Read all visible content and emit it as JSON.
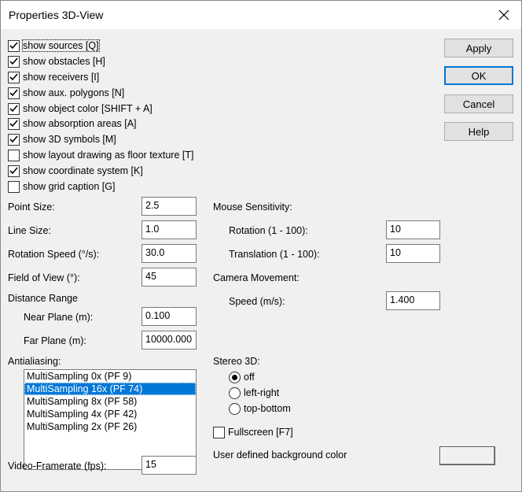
{
  "window": {
    "title": "Properties 3D-View"
  },
  "checkboxes": [
    {
      "label": "show sources [Q]",
      "checked": true
    },
    {
      "label": "show obstacles [H]",
      "checked": true
    },
    {
      "label": "show receivers [I]",
      "checked": true
    },
    {
      "label": "show aux. polygons [N]",
      "checked": true
    },
    {
      "label": "show object color [SHIFT + A]",
      "checked": true
    },
    {
      "label": "show absorption areas [A]",
      "checked": true
    },
    {
      "label": "show 3D symbols [M]",
      "checked": true
    },
    {
      "label": "show layout drawing as floor texture [T]",
      "checked": false
    },
    {
      "label": "show coordinate system [K]",
      "checked": true
    },
    {
      "label": "show grid caption [G]",
      "checked": false
    }
  ],
  "buttons": {
    "apply": "Apply",
    "ok": "OK",
    "cancel": "Cancel",
    "help": "Help"
  },
  "left_fields": {
    "point_size": {
      "label": "Point Size:",
      "value": "2.5"
    },
    "line_size": {
      "label": "Line Size:",
      "value": "1.0"
    },
    "rotation_speed": {
      "label": "Rotation Speed (°/s):",
      "value": "30.0"
    },
    "field_of_view": {
      "label": "Field of View (°):",
      "value": "45"
    },
    "distance_range_label": "Distance Range",
    "near_plane": {
      "label": "Near Plane (m):",
      "value": "0.100"
    },
    "far_plane": {
      "label": "Far Plane (m):",
      "value": "10000.000"
    }
  },
  "antialiasing": {
    "label": "Antialiasing:",
    "options": [
      "MultiSampling 0x (PF 9)",
      "MultiSampling 16x (PF 74)",
      "MultiSampling 8x (PF 58)",
      "MultiSampling 4x (PF 42)",
      "MultiSampling 2x (PF 26)"
    ],
    "selected_index": 1
  },
  "video_framerate": {
    "label": "Video-Framerate (fps):",
    "value": "15"
  },
  "mouse_sensitivity": {
    "label": "Mouse Sensitivity:",
    "rotation": {
      "label": "Rotation (1 - 100):",
      "value": "10"
    },
    "translation": {
      "label": "Translation (1 - 100):",
      "value": "10"
    }
  },
  "camera_movement": {
    "label": "Camera Movement:",
    "speed": {
      "label": "Speed (m/s):",
      "value": "1.400"
    }
  },
  "stereo_3d": {
    "label": "Stereo 3D:",
    "options": [
      "off",
      "left-right",
      "top-bottom"
    ],
    "selected": "off"
  },
  "fullscreen": {
    "label": "Fullscreen [F7]",
    "checked": false
  },
  "background_color": {
    "label": "User defined background color",
    "color": "#f0f0f0"
  }
}
